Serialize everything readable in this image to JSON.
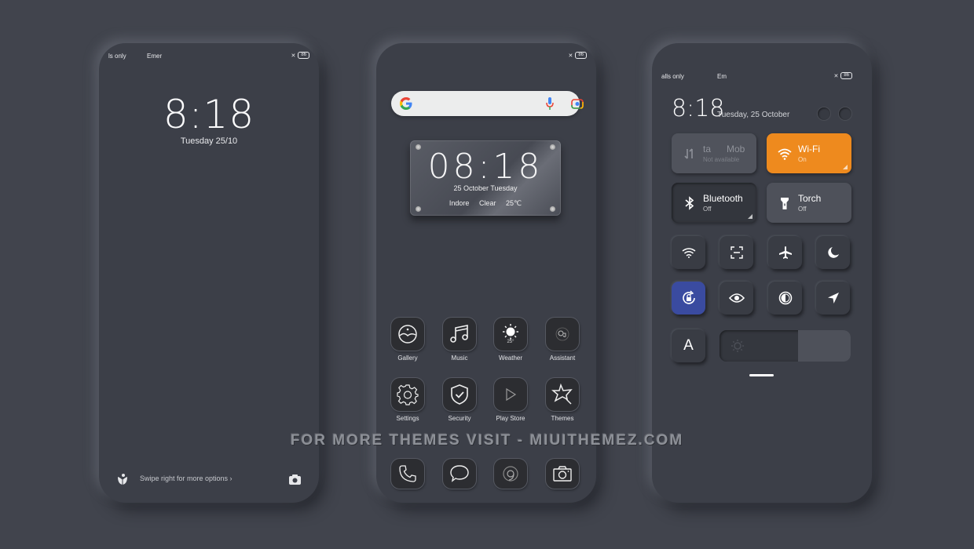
{
  "watermark": "FOR MORE THEMES VISIT - MIUITHEMEZ.COM",
  "lock_screen": {
    "status": {
      "carrier1": "ls only",
      "carrier2": "Emer",
      "battery": "86",
      "sim_icon": "no-sim-icon"
    },
    "time": "8:18",
    "date": "Tuesday 25/10",
    "bottom": {
      "left_icon": "flower-icon",
      "hint": "Swipe right for more options ›",
      "right_icon": "camera-icon"
    }
  },
  "home_screen": {
    "status": {
      "battery": "86"
    },
    "search": {
      "placeholder": "",
      "icons": [
        "google-g-icon",
        "mic-icon",
        "lens-icon"
      ]
    },
    "widget": {
      "time": "08:18",
      "date": "25 October Tuesday",
      "city": "Indore",
      "condition": "Clear",
      "temp": "25℃"
    },
    "apps": [
      {
        "label": "Gallery",
        "icon": "gallery-icon"
      },
      {
        "label": "Music",
        "icon": "music-icon"
      },
      {
        "label": "Weather",
        "icon": "weather-icon",
        "badge": "25°"
      },
      {
        "label": "Assistant",
        "icon": "assistant-icon"
      },
      {
        "label": "Settings",
        "icon": "settings-icon"
      },
      {
        "label": "Security",
        "icon": "security-icon"
      },
      {
        "label": "Play Store",
        "icon": "play-store-icon"
      },
      {
        "label": "Themes",
        "icon": "themes-icon"
      }
    ],
    "dock": [
      {
        "icon": "phone-icon"
      },
      {
        "icon": "messages-icon"
      },
      {
        "icon": "chrome-icon"
      },
      {
        "icon": "camera-icon"
      }
    ]
  },
  "control_center": {
    "status": {
      "carrier1": "alls only",
      "carrier2": "Em",
      "battery": "86"
    },
    "time": "8:18",
    "date": "Tuesday, 25 October",
    "tiles": [
      {
        "title": "ta      Mob",
        "subtitle": "Not available",
        "icon": "mobile-data-icon",
        "state": "disabled"
      },
      {
        "title": "Wi-Fi",
        "subtitle": "On",
        "icon": "wifi-icon",
        "state": "on"
      },
      {
        "title": "Bluetooth",
        "subtitle": "Off",
        "icon": "bluetooth-icon",
        "state": "off"
      },
      {
        "title": "Torch",
        "subtitle": "Off",
        "icon": "torch-icon",
        "state": "off"
      }
    ],
    "toggles": [
      {
        "name": "hotspot",
        "icon": "hotspot-icon",
        "active": false
      },
      {
        "name": "scanner",
        "icon": "scan-icon",
        "active": false
      },
      {
        "name": "airplane",
        "icon": "airplane-icon",
        "active": false
      },
      {
        "name": "dark-mode",
        "icon": "moon-icon",
        "active": false
      },
      {
        "name": "rotation-lock",
        "icon": "rotation-lock-icon",
        "active": true
      },
      {
        "name": "reading-mode",
        "icon": "eye-icon",
        "active": false
      },
      {
        "name": "contrast",
        "icon": "contrast-icon",
        "active": false
      },
      {
        "name": "location",
        "icon": "location-icon",
        "active": false
      }
    ],
    "font_button": "A",
    "brightness": 0.6,
    "colors": {
      "wifi_active": "#ee8a1e",
      "toggle_active": "#3a4ba0"
    }
  }
}
